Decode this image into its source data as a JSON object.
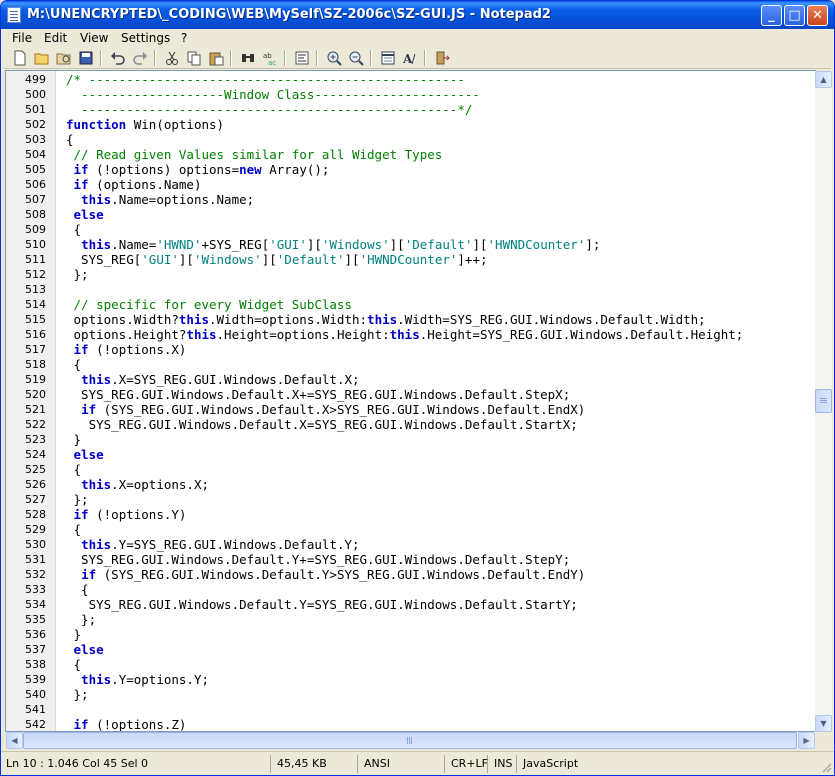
{
  "window": {
    "title": "M:\\UNENCRYPTED\\_CODING\\WEB\\MySelf\\SZ-2006c\\SZ-GUI.JS - Notepad2",
    "min_glyph": "_",
    "max_glyph": "□",
    "close_glyph": "✕"
  },
  "menu": [
    "File",
    "Edit",
    "View",
    "Settings",
    "?"
  ],
  "toolbar": {
    "icons": [
      "new-file-icon",
      "open-file-icon",
      "browse-icon",
      "save-icon",
      "undo-icon",
      "redo-icon",
      "cut-icon",
      "copy-icon",
      "paste-icon",
      "find-icon",
      "replace-icon",
      "word-wrap-icon",
      "zoom-in-icon",
      "zoom-out-icon",
      "scheme-icon",
      "font-icon",
      "exit-icon"
    ]
  },
  "code_lines": [
    {
      "n": "499",
      "t": "/* --------------------------------------------------"
    },
    {
      "n": "500",
      "t": "  -------------------Window Class----------------------"
    },
    {
      "n": "501",
      "t": "  --------------------------------------------------*/"
    },
    {
      "n": "502",
      "t": "function Win(options)"
    },
    {
      "n": "503",
      "t": "{"
    },
    {
      "n": "504",
      "t": " // Read given Values similar for all Widget Types"
    },
    {
      "n": "505",
      "t": " if (!options) options=new Array();"
    },
    {
      "n": "506",
      "t": " if (options.Name)"
    },
    {
      "n": "507",
      "t": "  this.Name=options.Name;"
    },
    {
      "n": "508",
      "t": " else"
    },
    {
      "n": "509",
      "t": " {"
    },
    {
      "n": "510",
      "t": "  this.Name='HWND'+SYS_REG['GUI']['Windows']['Default']['HWNDCounter'];"
    },
    {
      "n": "511",
      "t": "  SYS_REG['GUI']['Windows']['Default']['HWNDCounter']++;"
    },
    {
      "n": "512",
      "t": " };"
    },
    {
      "n": "513",
      "t": ""
    },
    {
      "n": "514",
      "t": " // specific for every Widget SubClass"
    },
    {
      "n": "515",
      "t": " options.Width?this.Width=options.Width:this.Width=SYS_REG.GUI.Windows.Default.Width;"
    },
    {
      "n": "516",
      "t": " options.Height?this.Height=options.Height:this.Height=SYS_REG.GUI.Windows.Default.Height;"
    },
    {
      "n": "517",
      "t": " if (!options.X)"
    },
    {
      "n": "518",
      "t": " {"
    },
    {
      "n": "519",
      "t": "  this.X=SYS_REG.GUI.Windows.Default.X;"
    },
    {
      "n": "520",
      "t": "  SYS_REG.GUI.Windows.Default.X+=SYS_REG.GUI.Windows.Default.StepX;"
    },
    {
      "n": "521",
      "t": "  if (SYS_REG.GUI.Windows.Default.X>SYS_REG.GUI.Windows.Default.EndX)"
    },
    {
      "n": "522",
      "t": "   SYS_REG.GUI.Windows.Default.X=SYS_REG.GUI.Windows.Default.StartX;"
    },
    {
      "n": "523",
      "t": " }"
    },
    {
      "n": "524",
      "t": " else"
    },
    {
      "n": "525",
      "t": " {"
    },
    {
      "n": "526",
      "t": "  this.X=options.X;"
    },
    {
      "n": "527",
      "t": " };"
    },
    {
      "n": "528",
      "t": " if (!options.Y)"
    },
    {
      "n": "529",
      "t": " {"
    },
    {
      "n": "530",
      "t": "  this.Y=SYS_REG.GUI.Windows.Default.Y;"
    },
    {
      "n": "531",
      "t": "  SYS_REG.GUI.Windows.Default.Y+=SYS_REG.GUI.Windows.Default.StepY;"
    },
    {
      "n": "532",
      "t": "  if (SYS_REG.GUI.Windows.Default.Y>SYS_REG.GUI.Windows.Default.EndY)"
    },
    {
      "n": "533",
      "t": "  {"
    },
    {
      "n": "534",
      "t": "   SYS_REG.GUI.Windows.Default.Y=SYS_REG.GUI.Windows.Default.StartY;"
    },
    {
      "n": "535",
      "t": "  };"
    },
    {
      "n": "536",
      "t": " }"
    },
    {
      "n": "537",
      "t": " else"
    },
    {
      "n": "538",
      "t": " {"
    },
    {
      "n": "539",
      "t": "  this.Y=options.Y;"
    },
    {
      "n": "540",
      "t": " };"
    },
    {
      "n": "541",
      "t": ""
    },
    {
      "n": "542",
      "t": " if (!options.Z)"
    }
  ],
  "status": {
    "position": "Ln 10 : 1.046   Col 45   Sel 0",
    "size": "45,45 KB",
    "encoding": "ANSI",
    "eol": "CR+LF",
    "mode": "INS",
    "lexer": "JavaScript"
  },
  "colors": {
    "comment": "#008000",
    "keyword": "#0000c8",
    "string": "#008080",
    "titlebar": "#0a5ee8"
  }
}
